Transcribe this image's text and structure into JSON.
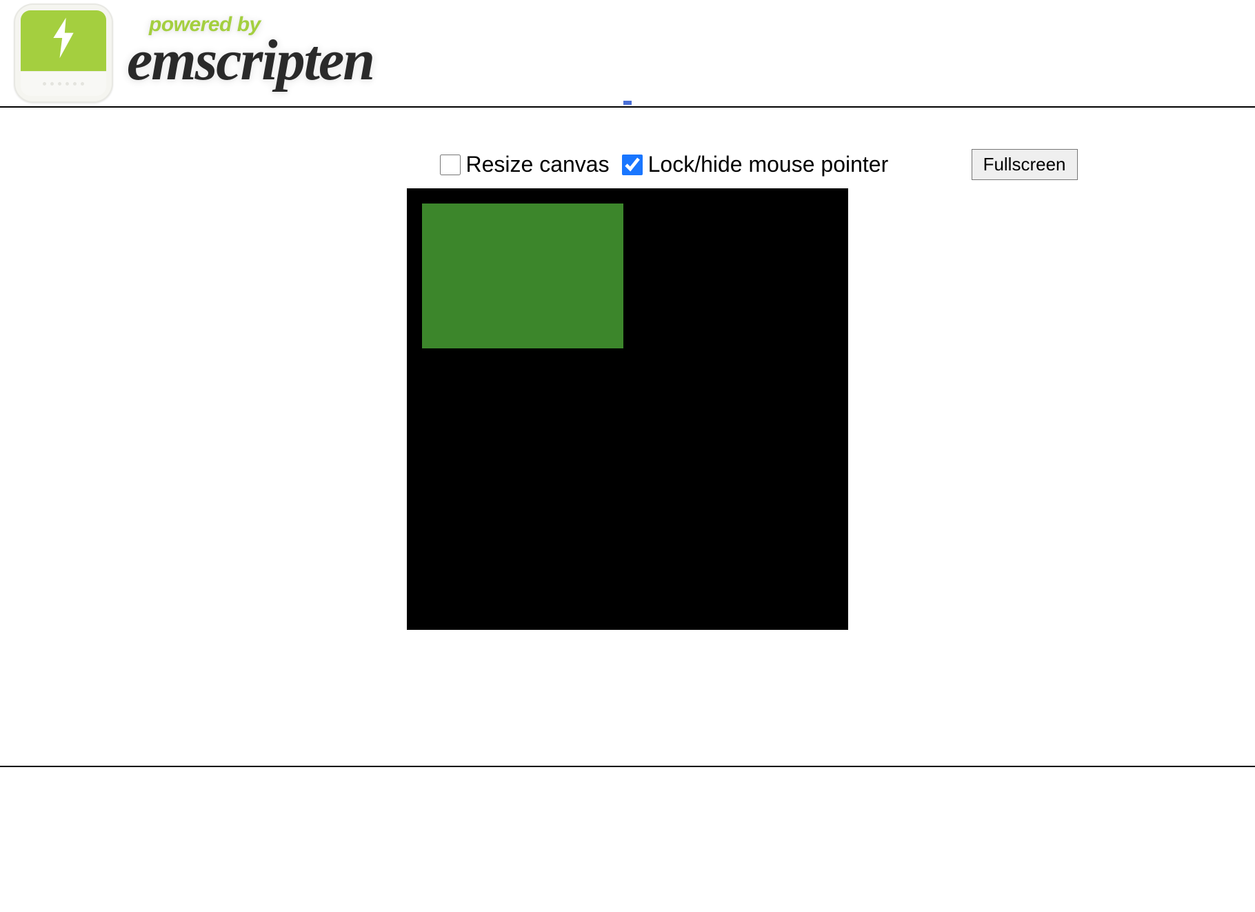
{
  "header": {
    "powered_by": "powered by",
    "brand": "emscripten"
  },
  "controls": {
    "resize_label": "Resize canvas",
    "resize_checked": false,
    "lock_label": "Lock/hide mouse pointer",
    "lock_checked": true,
    "fullscreen_label": "Fullscreen"
  },
  "canvas": {
    "bg_color": "#000000",
    "rect_color": "#3c862b"
  }
}
